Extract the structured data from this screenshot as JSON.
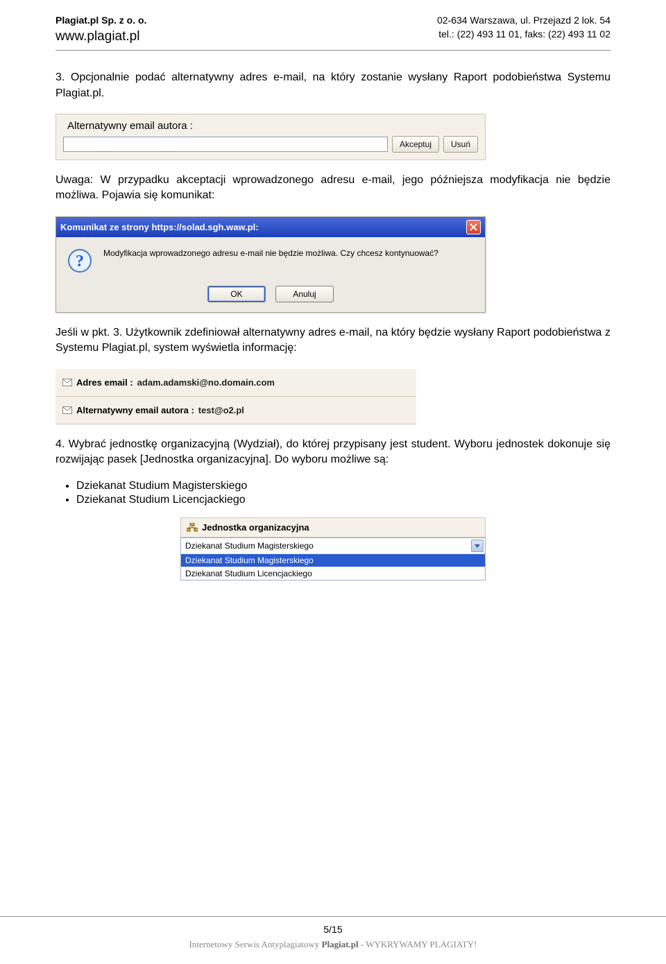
{
  "header": {
    "company": "Plagiat.pl Sp. z o. o.",
    "url": "www.plagiat.pl",
    "address": "02-634 Warszawa, ul. Przejazd 2 lok. 54",
    "phone": "tel.: (22) 493 11 01, faks: (22)  493 11 02"
  },
  "section3": "3.  Opcjonalnie  podać  alternatywny  adres  e-mail,  na  który  zostanie  wysłany  Raport podobieństwa Systemu Plagiat.pl.",
  "panel_alt_email": {
    "label": "Alternatywny email autora :",
    "accept": "Akceptuj",
    "remove": "Usuń"
  },
  "warning": "Uwaga: W przypadku akceptacji wprowadzonego adresu e-mail, jego późniejsza modyfikacja nie będzie możliwa. Pojawia się komunikat:",
  "dialog": {
    "title": "Komunikat ze strony https://solad.sgh.waw.pl:",
    "message": "Modyfikacja wprowadzonego adresu e-mail nie będzie możliwa. Czy chcesz kontynuować?",
    "ok": "OK",
    "cancel": "Anuluj"
  },
  "if_text": "Jeśli w pkt. 3. Użytkownik zdefiniował alternatywny adres e-mail, na który będzie wysłany Raport podobieństwa z Systemu Plagiat.pl, system wyświetla informację:",
  "email_rows": {
    "addr_label": "Adres email :",
    "addr_value": "adam.adamski@no.domain.com",
    "alt_label": "Alternatywny email autora :",
    "alt_value": "test@o2.pl"
  },
  "section4": "4.  Wybrać  jednostkę  organizacyjną  (Wydział),  do  której  przypisany  jest  student.  Wyboru jednostek dokonuje się rozwijając pasek [Jednostka organizacyjna]. Do wyboru możliwe są:",
  "bullets": {
    "a": "Dziekanat Studium Magisterskiego",
    "b": "Dziekanat Studium Licencjackiego"
  },
  "dropdown": {
    "header": "Jednostka organizacyjna",
    "selected": "Dziekanat Studium Magisterskiego",
    "opt1": "Dziekanat Studium Magisterskiego",
    "opt2": "Dziekanat Studium Licencjackiego"
  },
  "footer": {
    "page": "5/15",
    "line_pre": "Internetowy Serwis Antyplagiatowy ",
    "line_bold": "Plagiat.pl",
    "line_post": " - WYKRYWAMY PLAGIATY!"
  }
}
